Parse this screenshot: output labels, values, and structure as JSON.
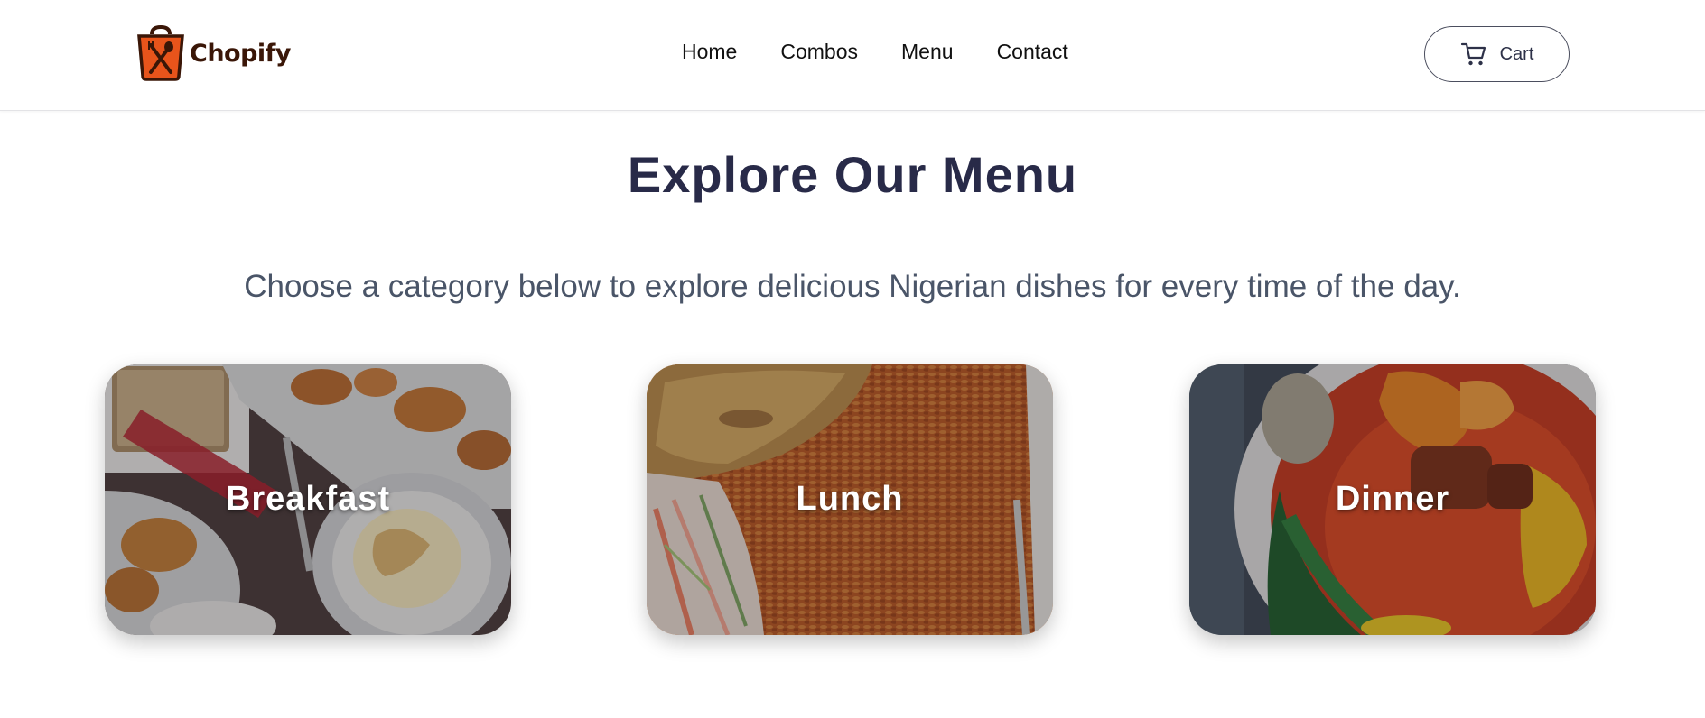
{
  "header": {
    "logo_text": "Chopify",
    "logo_icon": "bag-fork-spoon-icon",
    "nav": [
      {
        "label": "Home"
      },
      {
        "label": "Combos"
      },
      {
        "label": "Menu"
      },
      {
        "label": "Contact"
      }
    ],
    "cart_label": "Cart",
    "cart_icon": "cart-icon"
  },
  "main": {
    "title": "Explore Our Menu",
    "subtitle": "Choose a category below to explore delicious Nigerian dishes for every time of the day.",
    "categories": [
      {
        "label": "Breakfast"
      },
      {
        "label": "Lunch"
      },
      {
        "label": "Dinner"
      }
    ]
  },
  "colors": {
    "title": "#282a48",
    "subtitle": "#4a5568",
    "logo_accent": "#e8541b",
    "logo_text": "#3a1607"
  }
}
